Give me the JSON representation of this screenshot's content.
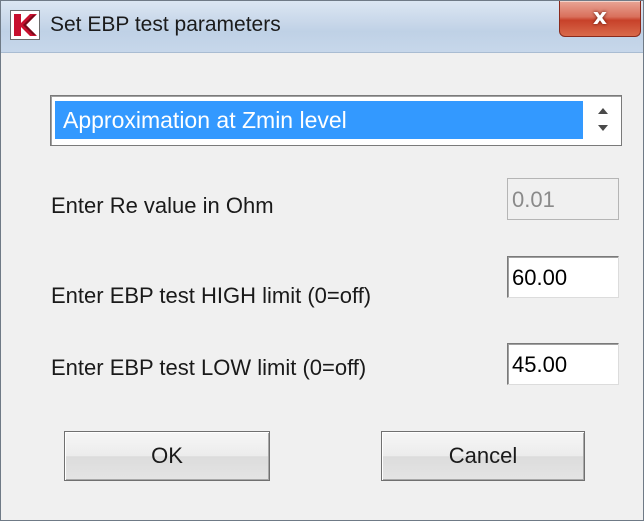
{
  "window": {
    "title": "Set EBP test parameters",
    "close_label": "x"
  },
  "mode_select": {
    "selected": "Approximation at Zmin level"
  },
  "re_value": {
    "label": "Enter Re value in Ohm",
    "value": "0.01",
    "enabled": false
  },
  "high_limit": {
    "label": "Enter EBP test HIGH limit  (0=off)",
    "value": "60.00"
  },
  "low_limit": {
    "label": "Enter EBP test LOW limit  (0=off)",
    "value": "45.00"
  },
  "buttons": {
    "ok": "OK",
    "cancel": "Cancel"
  },
  "icons": {
    "app": "k-logo-icon",
    "close": "close-icon",
    "spin_up": "chevron-up-icon",
    "spin_down": "chevron-down-icon"
  },
  "colors": {
    "selection": "#3399ff",
    "logo_red": "#c8102e",
    "close_red": "#c7412a"
  }
}
